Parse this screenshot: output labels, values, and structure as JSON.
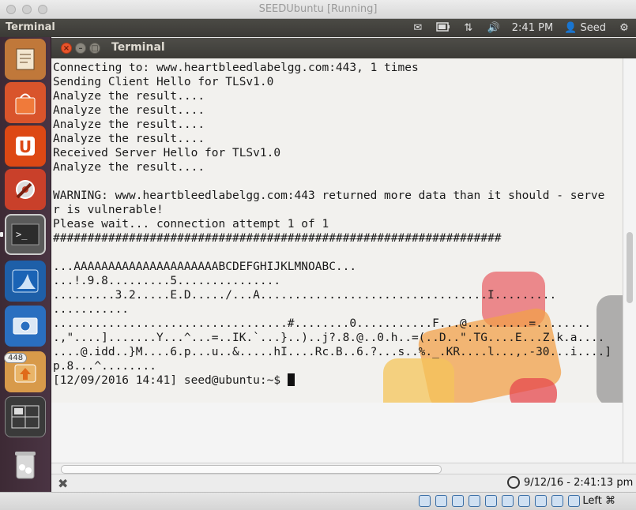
{
  "host_window": {
    "title": "SEEDUbuntu [Running]"
  },
  "panel": {
    "app_name": "Terminal",
    "time": "2:41 PM",
    "user": "Seed",
    "icons": [
      "mail-icon",
      "battery-icon",
      "network-icon",
      "volume-icon",
      "user-icon",
      "gear-icon"
    ]
  },
  "launcher": {
    "items": [
      "document-viewer",
      "software-center",
      "ubuntu-one",
      "system-settings",
      "terminal",
      "wireshark",
      "screenshot",
      "files-update",
      "workspace-switcher",
      "trash"
    ],
    "badge": "448"
  },
  "terminal": {
    "title": "Terminal",
    "lines": [
      "Connecting to: www.heartbleedlabelgg.com:443, 1 times",
      "Sending Client Hello for TLSv1.0",
      "Analyze the result....",
      "Analyze the result....",
      "Analyze the result....",
      "Analyze the result....",
      "Received Server Hello for TLSv1.0",
      "Analyze the result....",
      "",
      "WARNING: www.heartbleedlabelgg.com:443 returned more data than it should - serve",
      "r is vulnerable!",
      "Please wait... connection attempt 1 of 1",
      "#################################################################",
      "",
      "...AAAAAAAAAAAAAAAAAAAAABCDEFGHIJKLMNOABC...",
      "...!.9.8.........5...............",
      ".........3.2.....E.D...../...A.................................I.........",
      "...........",
      "..................................#........0...........F...@.........=........",
      ".,\"....].......Y...^...=..IK.`...}..)..j?.8.@..0.h..=(..D..\".TG....E...Z.k.a....",
      "....@.idd..}M....6.p...u..&.....hI....Rc.B..6.?...s..%._.KR....l...,.-30...i....]",
      "p.8...^........",
      ""
    ],
    "prompt": "[12/09/2016 14:41] seed@ubuntu:~$ "
  },
  "statusbar": {
    "timestamp": "9/12/16 - 2:41:13 pm"
  },
  "vbox": {
    "host_key": "Left ⌘"
  }
}
